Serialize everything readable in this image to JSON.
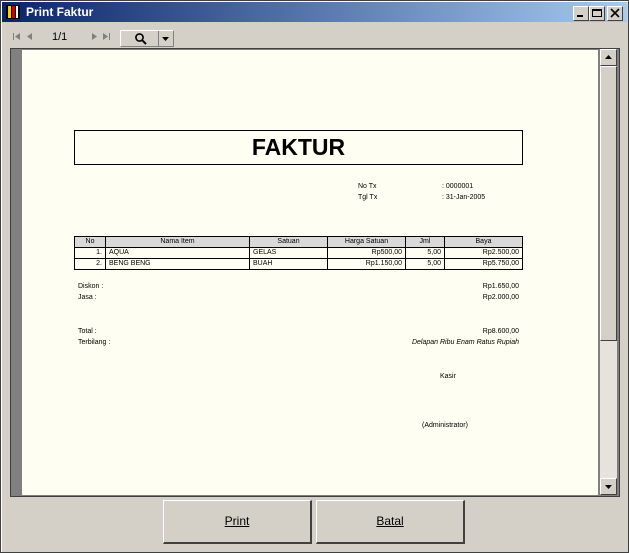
{
  "window": {
    "title": "Print Faktur"
  },
  "toolbar": {
    "page": "1/1"
  },
  "icons": {
    "first": "first-page-icon",
    "prev": "prev-page-icon",
    "next": "next-page-icon",
    "last": "last-page-icon",
    "zoom": "magnifier-icon",
    "dropdown": "chevron-down-icon"
  },
  "report": {
    "title": "FAKTUR",
    "no_tx_label": "No Tx",
    "no_tx_value": ": 0000001",
    "tgl_tx_label": "Tgl Tx",
    "tgl_tx_value": ": 31-Jan-2005",
    "columns": [
      "No",
      "Nama Item",
      "Satuan",
      "Harga Satuan",
      "Jml",
      "Baya"
    ],
    "rows": [
      [
        "1.",
        "AQUA",
        "GELAS",
        "Rp500,00",
        "5,00",
        "Rp2.500,00"
      ],
      [
        "2.",
        "BENG BENG",
        "BUAH",
        "Rp1.150,00",
        "5,00",
        "Rp5.750,00"
      ]
    ],
    "diskon_label": "Diskon :",
    "diskon_value": "Rp1.650,00",
    "jasa_label": "Jasa :",
    "jasa_value": "Rp2.000,00",
    "total_label": "Total :",
    "total_value": "Rp8.600,00",
    "terbilang_label": "Terbilang :",
    "terbilang_value": "Delapan Ribu Enam Ratus Rupiah",
    "kasir_label": "Kasir",
    "kasir_name": "(Administrator)"
  },
  "buttons": {
    "print": "Print",
    "batal": "Batal"
  }
}
